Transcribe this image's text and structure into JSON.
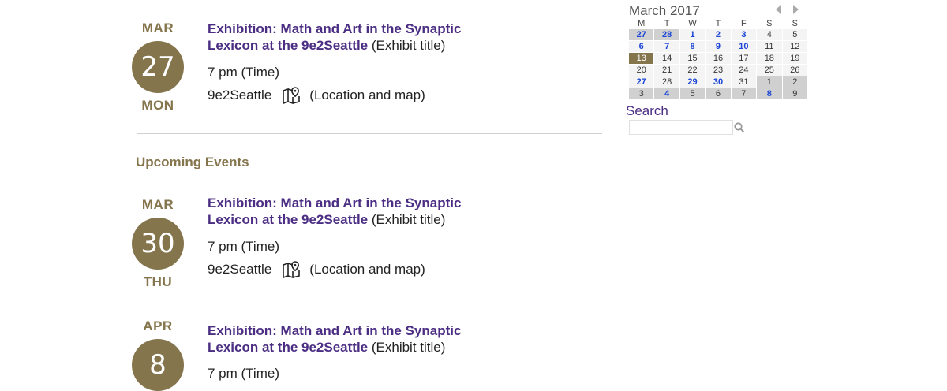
{
  "events": [
    {
      "month": "MAR",
      "day": "27",
      "weekday": "MON",
      "title_link": "Exhibition: Math and Art in the Synaptic Lexicon at the 9e2Seattle",
      "title_suffix": " (Exhibit title)",
      "time": "7 pm (Time)",
      "location": "9e2Seattle",
      "location_link": "(Location and map)",
      "map_icon": "map-pin-icon"
    },
    {
      "month": "MAR",
      "day": "30",
      "weekday": "THU",
      "title_link": "Exhibition: Math and Art in the Synaptic Lexicon at the 9e2Seattle",
      "title_suffix": " (Exhibit title)",
      "time": "7 pm (Time)",
      "location": "9e2Seattle",
      "location_link": "(Location and map)",
      "map_icon": "map-pin-icon"
    },
    {
      "month": "APR",
      "day": "8",
      "title_link": "Exhibition: Math and Art in the Synaptic Lexicon at the 9e2Seattle",
      "title_suffix": " (Exhibit title)",
      "time": "7 pm (Time)"
    }
  ],
  "upcoming_heading": "Upcoming Events",
  "calendar": {
    "title": "March 2017",
    "weekdays": [
      "M",
      "T",
      "W",
      "T",
      "F",
      "S",
      "S"
    ],
    "weeks": [
      [
        {
          "d": "27",
          "k": "gray-ev"
        },
        {
          "d": "28",
          "k": "gray-ev"
        },
        {
          "d": "1",
          "k": "ev"
        },
        {
          "d": "2",
          "k": "ev"
        },
        {
          "d": "3",
          "k": "ev"
        },
        {
          "d": "4",
          "k": "norm"
        },
        {
          "d": "5",
          "k": "norm"
        }
      ],
      [
        {
          "d": "6",
          "k": "ev"
        },
        {
          "d": "7",
          "k": "ev"
        },
        {
          "d": "8",
          "k": "ev"
        },
        {
          "d": "9",
          "k": "ev"
        },
        {
          "d": "10",
          "k": "ev"
        },
        {
          "d": "11",
          "k": "norm"
        },
        {
          "d": "12",
          "k": "norm"
        }
      ],
      [
        {
          "d": "13",
          "k": "today"
        },
        {
          "d": "14",
          "k": "norm"
        },
        {
          "d": "15",
          "k": "norm"
        },
        {
          "d": "16",
          "k": "norm"
        },
        {
          "d": "17",
          "k": "norm"
        },
        {
          "d": "18",
          "k": "norm"
        },
        {
          "d": "19",
          "k": "norm"
        }
      ],
      [
        {
          "d": "20",
          "k": "norm"
        },
        {
          "d": "21",
          "k": "norm"
        },
        {
          "d": "22",
          "k": "norm"
        },
        {
          "d": "23",
          "k": "norm"
        },
        {
          "d": "24",
          "k": "norm"
        },
        {
          "d": "25",
          "k": "norm"
        },
        {
          "d": "26",
          "k": "norm"
        }
      ],
      [
        {
          "d": "27",
          "k": "ev"
        },
        {
          "d": "28",
          "k": "norm"
        },
        {
          "d": "29",
          "k": "ev"
        },
        {
          "d": "30",
          "k": "ev"
        },
        {
          "d": "31",
          "k": "norm"
        },
        {
          "d": "1",
          "k": "gray"
        },
        {
          "d": "2",
          "k": "gray"
        }
      ],
      [
        {
          "d": "3",
          "k": "gray"
        },
        {
          "d": "4",
          "k": "gray-ev"
        },
        {
          "d": "5",
          "k": "gray"
        },
        {
          "d": "6",
          "k": "gray"
        },
        {
          "d": "7",
          "k": "gray"
        },
        {
          "d": "8",
          "k": "gray-ev"
        },
        {
          "d": "9",
          "k": "gray"
        }
      ]
    ],
    "prev_icon": "chevron-left-icon",
    "next_icon": "chevron-right-icon"
  },
  "search": {
    "label": "Search",
    "placeholder": "",
    "icon": "search-icon"
  },
  "colors": {
    "gold": "#85754d",
    "purple": "#4b2e83",
    "event_day": "#1a45d6",
    "muted_cell": "#d0d0d0"
  }
}
